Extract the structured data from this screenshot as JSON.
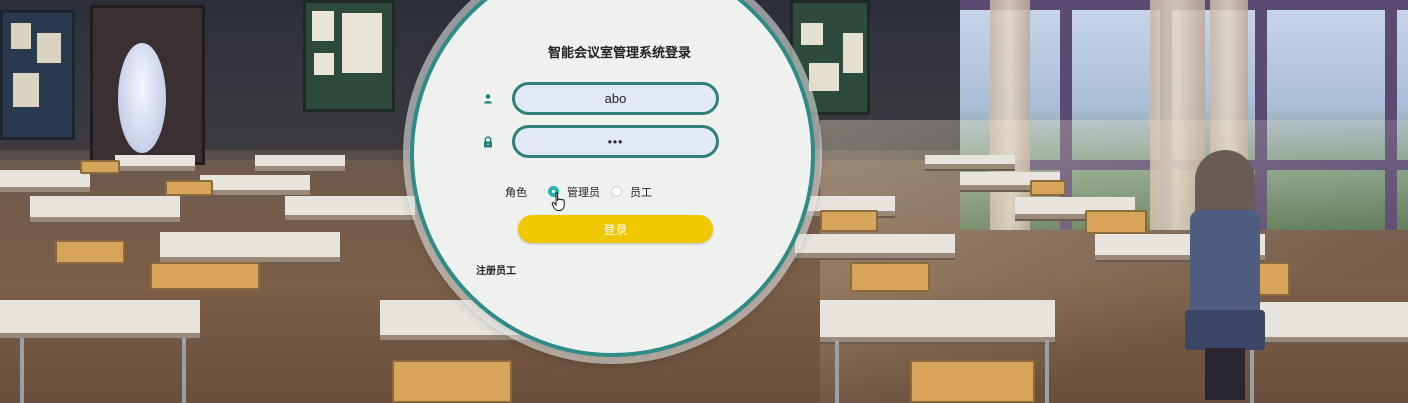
{
  "login": {
    "title": "智能会议室管理系统登录",
    "username_value": "abo",
    "password_value": "•••",
    "role_label": "角色",
    "roles": [
      {
        "label": "管理员",
        "selected": true
      },
      {
        "label": "员工",
        "selected": false
      }
    ],
    "submit_label": "登录",
    "register_label": "注册员工"
  },
  "colors": {
    "accent_teal": "#2e8b86",
    "button_yellow": "#f0c800",
    "field_bg": "#e2e8f5"
  },
  "icons": {
    "username": "user-icon",
    "password": "lock-icon",
    "pointer": "hand-pointer-icon"
  }
}
